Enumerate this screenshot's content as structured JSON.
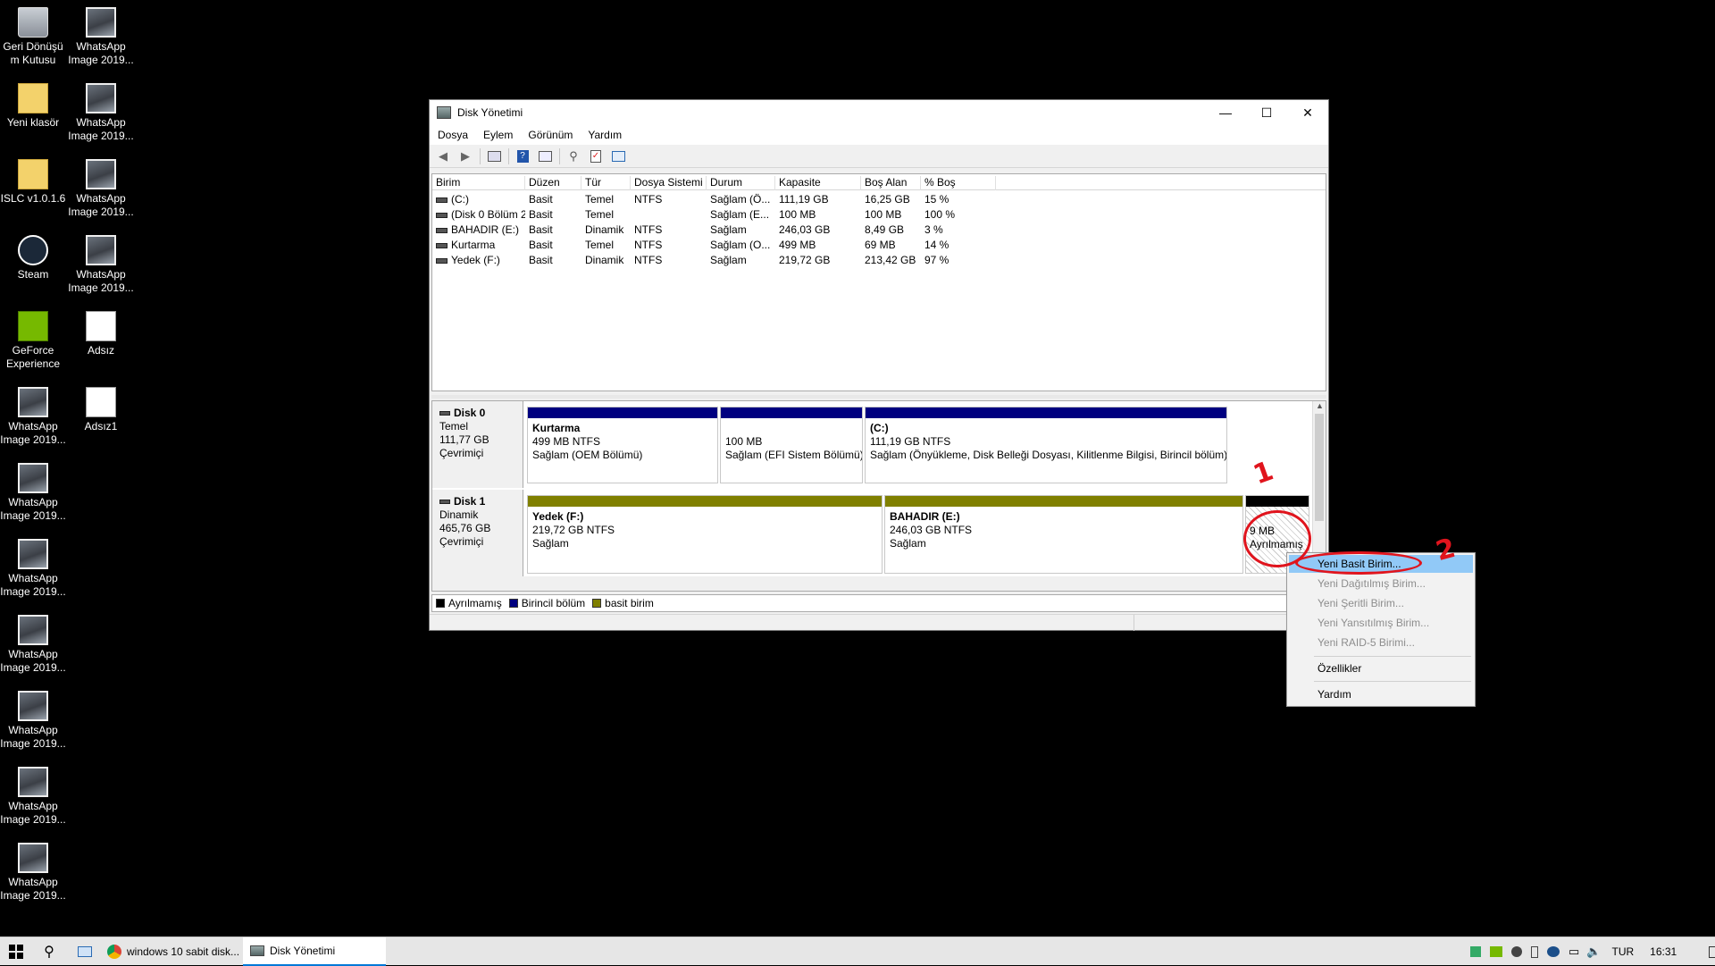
{
  "desktop": {
    "icons": [
      {
        "label": "Geri Dönüşü m Kutusu",
        "icon": "recycle-bin-icon"
      },
      {
        "label": "WhatsApp Image 2019...",
        "icon": "image-file-icon"
      },
      {
        "label": "Yeni klasör",
        "icon": "folder-icon"
      },
      {
        "label": "WhatsApp Image 2019...",
        "icon": "image-file-icon"
      },
      {
        "label": "ISLC v1.0.1.6",
        "icon": "zip-icon"
      },
      {
        "label": "WhatsApp Image 2019...",
        "icon": "image-file-icon"
      },
      {
        "label": "Steam",
        "icon": "steam-icon"
      },
      {
        "label": "WhatsApp Image 2019...",
        "icon": "image-file-icon"
      },
      {
        "label": "GeForce Experience",
        "icon": "nvidia-icon"
      },
      {
        "label": "Adsız",
        "icon": "image-file-icon"
      },
      {
        "label": "WhatsApp Image 2019...",
        "icon": "image-file-icon"
      },
      {
        "label": "Adsız1",
        "icon": "image-file-icon"
      },
      {
        "label": "WhatsApp Image 2019...",
        "icon": "image-file-icon"
      },
      {
        "label": "WhatsApp Image 2019...",
        "icon": "image-file-icon"
      },
      {
        "label": "WhatsApp Image 2019...",
        "icon": "image-file-icon"
      },
      {
        "label": "WhatsApp Image 2019...",
        "icon": "image-file-icon"
      },
      {
        "label": "WhatsApp Image 2019...",
        "icon": "image-file-icon"
      },
      {
        "label": "WhatsApp Image 2019...",
        "icon": "image-file-icon"
      }
    ]
  },
  "window": {
    "title": "Disk Yönetimi",
    "controls": {
      "minimize": "—",
      "maximize": "☐",
      "close": "✕"
    }
  },
  "menu": [
    "Dosya",
    "Eylem",
    "Görünüm",
    "Yardım"
  ],
  "list": {
    "columns": [
      "Birim",
      "Düzen",
      "Tür",
      "Dosya Sistemi",
      "Durum",
      "Kapasite",
      "Boş Alan",
      "% Boş"
    ],
    "rows": [
      [
        "(C:)",
        "Basit",
        "Temel",
        "NTFS",
        "Sağlam (Ö...",
        "111,19 GB",
        "16,25 GB",
        "15 %"
      ],
      [
        "(Disk 0 Bölüm 2)",
        "Basit",
        "Temel",
        "",
        "Sağlam (E...",
        "100 MB",
        "100 MB",
        "100 %"
      ],
      [
        "BAHADIR (E:)",
        "Basit",
        "Dinamik",
        "NTFS",
        "Sağlam",
        "246,03 GB",
        "8,49 GB",
        "3 %"
      ],
      [
        "Kurtarma",
        "Basit",
        "Temel",
        "NTFS",
        "Sağlam (O...",
        "499 MB",
        "69 MB",
        "14 %"
      ],
      [
        "Yedek (F:)",
        "Basit",
        "Dinamik",
        "NTFS",
        "Sağlam",
        "219,72 GB",
        "213,42 GB",
        "97 %"
      ]
    ]
  },
  "disks": [
    {
      "name": "Disk 0",
      "type": "Temel",
      "size": "111,77 GB",
      "status": "Çevrimiçi",
      "partitions": [
        {
          "title": "Kurtarma",
          "size": "499 MB NTFS",
          "status": "Sağlam (OEM Bölümü)"
        },
        {
          "title": "",
          "size": "100 MB",
          "status": "Sağlam (EFI Sistem Bölümü)"
        },
        {
          "title": "(C:)",
          "size": "111,19 GB NTFS",
          "status": "Sağlam (Önyükleme, Disk Belleği Dosyası, Kilitlenme Bilgisi, Birincil bölüm)"
        }
      ]
    },
    {
      "name": "Disk 1",
      "type": "Dinamik",
      "size": "465,76 GB",
      "status": "Çevrimiçi",
      "partitions": [
        {
          "title": "Yedek  (F:)",
          "size": "219,72 GB NTFS",
          "status": "Sağlam"
        },
        {
          "title": "BAHADIR  (E:)",
          "size": "246,03 GB NTFS",
          "status": "Sağlam"
        },
        {
          "title": "",
          "size": "9 MB",
          "status": "Ayrılmamış"
        }
      ]
    }
  ],
  "legend": [
    {
      "label": "Ayrılmamış",
      "color": "#000000"
    },
    {
      "label": "Birincil bölüm",
      "color": "#000080"
    },
    {
      "label": "basit birim",
      "color": "#808000"
    }
  ],
  "context_menu": {
    "items": [
      {
        "label": "Yeni Basit Birim...",
        "state": "highlighted"
      },
      {
        "label": "Yeni Dağıtılmış Birim...",
        "state": "disabled"
      },
      {
        "label": "Yeni Şeritli Birim...",
        "state": "disabled"
      },
      {
        "label": "Yeni Yansıtılmış Birim...",
        "state": "disabled"
      },
      {
        "label": "Yeni RAID-5 Birimi...",
        "state": "disabled"
      },
      {
        "label": "Özellikler",
        "state": "enabled"
      },
      {
        "label": "Yardım",
        "state": "enabled"
      }
    ]
  },
  "annotations": {
    "step1": "1",
    "step2": "2",
    "color": "#e0141d"
  },
  "colors": {
    "primary_partition": "#000080",
    "simple_volume": "#808000",
    "unallocated": "#000000",
    "menu_highlight": "#91c9f7"
  },
  "taskbar": {
    "tasks": [
      {
        "label": "windows 10 sabit disk...",
        "icon": "chrome-icon"
      },
      {
        "label": "Disk Yönetimi",
        "icon": "disk-management-icon"
      }
    ],
    "language": "TUR",
    "time": "16:31"
  }
}
